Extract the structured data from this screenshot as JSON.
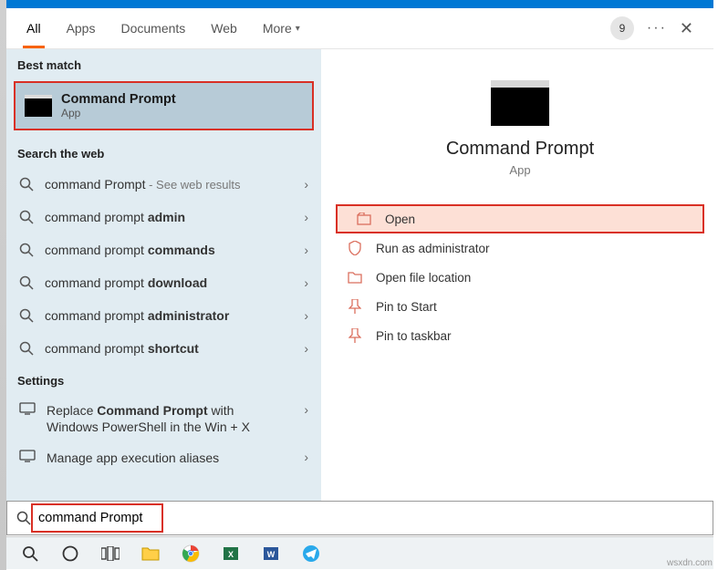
{
  "tabs": {
    "all": "All",
    "apps": "Apps",
    "documents": "Documents",
    "web": "Web",
    "more": "More"
  },
  "top_right": {
    "badge": "9"
  },
  "sections": {
    "best_match": "Best match",
    "web": "Search the web",
    "settings": "Settings"
  },
  "best_match": {
    "title": "Command Prompt",
    "subtitle": "App"
  },
  "web_results": [
    {
      "prefix": "command Prompt",
      "bold": "",
      "suffix": " - See web results"
    },
    {
      "prefix": "command prompt ",
      "bold": "admin",
      "suffix": ""
    },
    {
      "prefix": "command prompt ",
      "bold": "commands",
      "suffix": ""
    },
    {
      "prefix": "command prompt ",
      "bold": "download",
      "suffix": ""
    },
    {
      "prefix": "command prompt ",
      "bold": "administrator",
      "suffix": ""
    },
    {
      "prefix": "command prompt ",
      "bold": "shortcut",
      "suffix": ""
    }
  ],
  "settings_items": [
    {
      "line1": "Replace ",
      "bold": "Command Prompt",
      "line1b": " with",
      "line2": "Windows PowerShell in the Win + X"
    },
    {
      "line1": "Manage app execution aliases",
      "bold": "",
      "line1b": "",
      "line2": ""
    }
  ],
  "preview": {
    "title": "Command Prompt",
    "subtitle": "App"
  },
  "actions": {
    "open": "Open",
    "run_admin": "Run as administrator",
    "file_loc": "Open file location",
    "pin_start": "Pin to Start",
    "pin_taskbar": "Pin to taskbar"
  },
  "search": {
    "value": "command Prompt"
  },
  "watermark": "wsxdn.com"
}
